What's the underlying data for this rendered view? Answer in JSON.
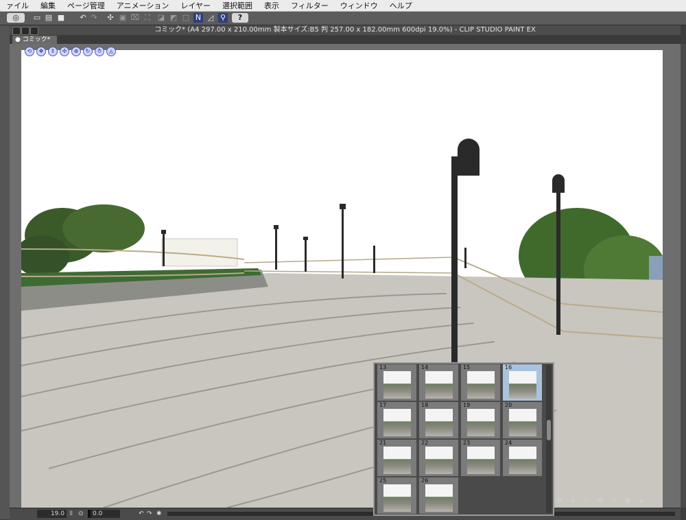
{
  "menubar": {
    "items": [
      "ァイル",
      "編集",
      "ページ管理",
      "アニメーション",
      "レイヤー",
      "選択範囲",
      "表示",
      "フィルター",
      "ウィンドウ",
      "ヘルプ"
    ]
  },
  "window": {
    "title": "コミック* (A4 297.00 x 210.00mm 製本サイズ:B5 判 257.00 x 182.00mm 600dpi 19.0%)  - CLIP STUDIO PAINT EX",
    "tab_label": "コミック*"
  },
  "toolbar": {
    "help_glyph": "?"
  },
  "statusbar": {
    "zoom": "19.0",
    "angle": "0.0"
  },
  "thumbnails": {
    "items": [
      {
        "num": "13",
        "selected": false
      },
      {
        "num": "14",
        "selected": false
      },
      {
        "num": "15",
        "selected": false
      },
      {
        "num": "16",
        "selected": true
      },
      {
        "num": "17",
        "selected": false
      },
      {
        "num": "18",
        "selected": false
      },
      {
        "num": "19",
        "selected": false
      },
      {
        "num": "20",
        "selected": false
      },
      {
        "num": "21",
        "selected": false
      },
      {
        "num": "22",
        "selected": false
      },
      {
        "num": "23",
        "selected": false
      },
      {
        "num": "24",
        "selected": false
      },
      {
        "num": "25",
        "selected": false
      },
      {
        "num": "26",
        "selected": false
      }
    ]
  },
  "colors": {
    "accent_blue": "#4a56b8",
    "selected_thumb": "#a9c3dc",
    "sky": "#ffffff",
    "foliage": "#3d5a2a",
    "pavement": "#c9c6c0",
    "lamp": "#2a2a2a"
  }
}
